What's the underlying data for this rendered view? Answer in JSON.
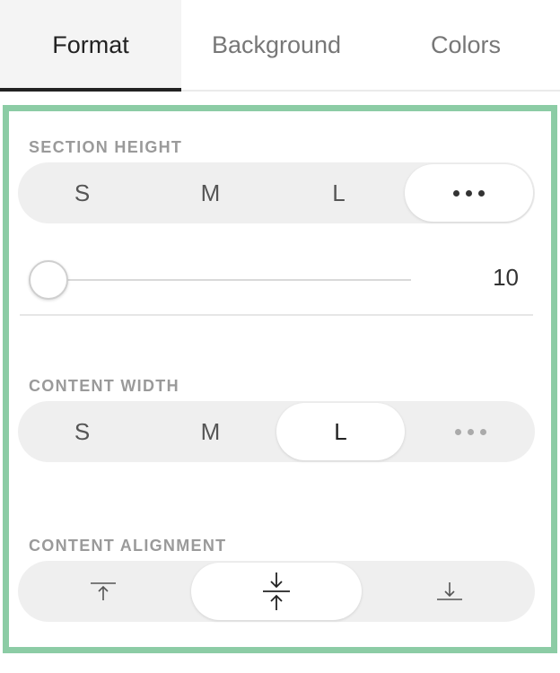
{
  "tabs": [
    {
      "label": "Format",
      "active": true
    },
    {
      "label": "Background",
      "active": false
    },
    {
      "label": "Colors",
      "active": false
    }
  ],
  "section_height": {
    "label": "SECTION HEIGHT",
    "options": [
      "S",
      "M",
      "L"
    ],
    "more_icon": "more-dots-icon",
    "selected": "more",
    "slider_value": "10"
  },
  "content_width": {
    "label": "CONTENT WIDTH",
    "options": [
      "S",
      "M",
      "L"
    ],
    "more_icon": "more-dots-icon",
    "selected": "L"
  },
  "content_alignment": {
    "label": "CONTENT ALIGNMENT",
    "options": [
      "align-top-icon",
      "align-middle-icon",
      "align-bottom-icon"
    ],
    "selected": "align-middle-icon"
  },
  "colors": {
    "highlight_border": "#8ccca5",
    "active_tab_underline": "#222222",
    "segment_bg": "#efefef"
  }
}
